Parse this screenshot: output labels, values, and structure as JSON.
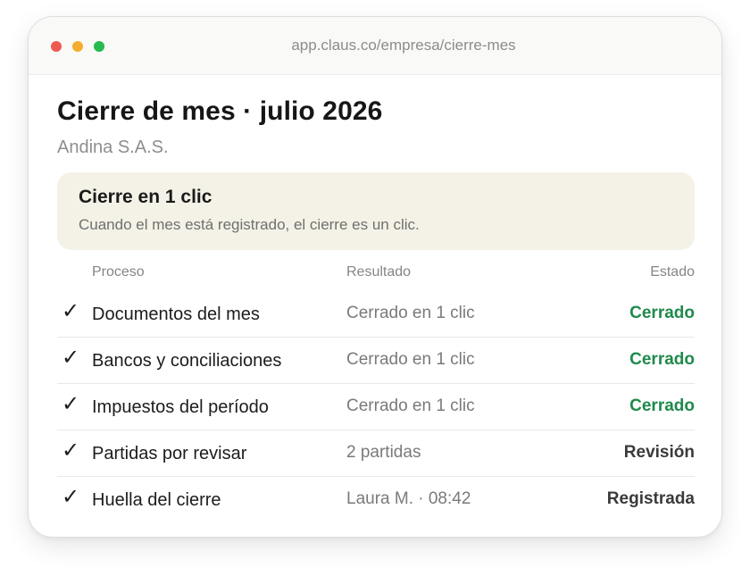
{
  "window": {
    "url": "app.claus.co/empresa/cierre-mes",
    "controls": {
      "close_color": "#ec5a52",
      "minimize_color": "#f4ad2f",
      "maximize_color": "#27ba4d"
    }
  },
  "page": {
    "title": "Cierre de mes · julio 2026",
    "company": "Andina S.A.S."
  },
  "banner": {
    "title": "Cierre en 1 clic",
    "text": "Cuando el mes está registrado, el cierre es un clic."
  },
  "table": {
    "headers": {
      "process": "Proceso",
      "result": "Resultado",
      "status": "Estado"
    },
    "rows": [
      {
        "check": "✓",
        "process": "Documentos del mes",
        "result": "Cerrado en 1 clic",
        "status": "Cerrado",
        "status_color": "#1f8a4c"
      },
      {
        "check": "✓",
        "process": "Bancos y conciliaciones",
        "result": "Cerrado en 1 clic",
        "status": "Cerrado",
        "status_color": "#1f8a4c"
      },
      {
        "check": "✓",
        "process": "Impuestos del período",
        "result": "Cerrado en 1 clic",
        "status": "Cerrado",
        "status_color": "#1f8a4c"
      },
      {
        "check": "✓",
        "process": "Partidas por revisar",
        "result": "2 partidas",
        "status": "Revisión",
        "status_color": "#3a3a3a"
      },
      {
        "check": "✓",
        "process": "Huella del cierre",
        "result": "Laura M. · 08:42",
        "status": "Registrada",
        "status_color": "#3a3a3a"
      }
    ]
  }
}
